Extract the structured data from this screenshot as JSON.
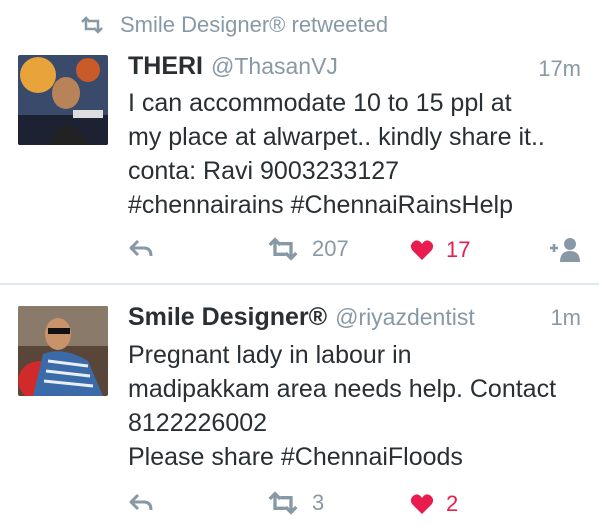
{
  "retweet_context": {
    "text": "Smile Designer® retweeted",
    "icon": "retweet-icon"
  },
  "tweets": [
    {
      "name": "THERI",
      "handle": "@ThasanVJ",
      "time": "17m",
      "text": "I can accommodate 10 to 15 ppl at\nmy place at alwarpet.. kindly share it..\nconta: Ravi 9003233127\n#chennairains #ChennaiRainsHelp",
      "retweets": "207",
      "likes": "17",
      "avatar_icon": "avatar-image"
    },
    {
      "name": "Smile Designer®",
      "handle": "@riyazdentist",
      "time": "1m",
      "text": "Pregnant  lady in labour in\nmadipakkam area needs help. Contact\n8122226002\nPlease share #ChennaiFloods",
      "retweets": "3",
      "likes": "2",
      "avatar_icon": "avatar-image"
    }
  ],
  "colors": {
    "muted": "#8899a6",
    "text": "#292f33",
    "like": "#e81c4f",
    "divider": "#e1e8ed"
  }
}
